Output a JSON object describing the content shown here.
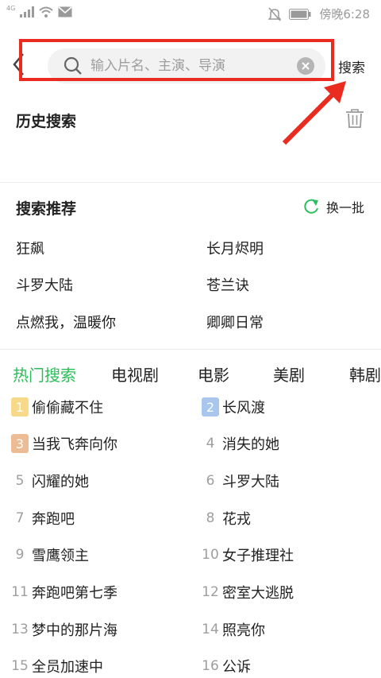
{
  "colors": {
    "accent": "#2dbd5a",
    "annotation": "#ea2b1f",
    "rank1": "#f8d98a",
    "rank2": "#a9c6ee",
    "rank3": "#ecbc96"
  },
  "status": {
    "network": "4G",
    "time_text": "傍晚6:28"
  },
  "search": {
    "placeholder": "输入片名、主演、导演",
    "value": "",
    "button_label": "搜索"
  },
  "history": {
    "title": "历史搜索"
  },
  "recommend": {
    "title": "搜索推荐",
    "refresh_label": "换一批",
    "items": [
      "狂飙",
      "长月烬明",
      "斗罗大陆",
      "苍兰诀",
      "点燃我，温暖你",
      "卿卿日常"
    ]
  },
  "tabs": [
    {
      "label": "热门搜索",
      "active": true
    },
    {
      "label": "电视剧",
      "active": false
    },
    {
      "label": "电影",
      "active": false
    },
    {
      "label": "美剧",
      "active": false
    },
    {
      "label": "韩剧",
      "active": false
    }
  ],
  "hot_list": [
    {
      "rank": "1",
      "name": "偷偷藏不住"
    },
    {
      "rank": "2",
      "name": "长风渡"
    },
    {
      "rank": "3",
      "name": "当我飞奔向你"
    },
    {
      "rank": "4",
      "name": "消失的她"
    },
    {
      "rank": "5",
      "name": "闪耀的她"
    },
    {
      "rank": "6",
      "name": "斗罗大陆"
    },
    {
      "rank": "7",
      "name": "奔跑吧"
    },
    {
      "rank": "8",
      "name": "花戎"
    },
    {
      "rank": "9",
      "name": "雪鹰领主"
    },
    {
      "rank": "10",
      "name": "女子推理社"
    },
    {
      "rank": "11",
      "name": "奔跑吧第七季"
    },
    {
      "rank": "12",
      "name": "密室大逃脱"
    },
    {
      "rank": "13",
      "name": "梦中的那片海"
    },
    {
      "rank": "14",
      "name": "照亮你"
    },
    {
      "rank": "15",
      "name": "全员加速中"
    },
    {
      "rank": "16",
      "name": "公诉"
    }
  ]
}
